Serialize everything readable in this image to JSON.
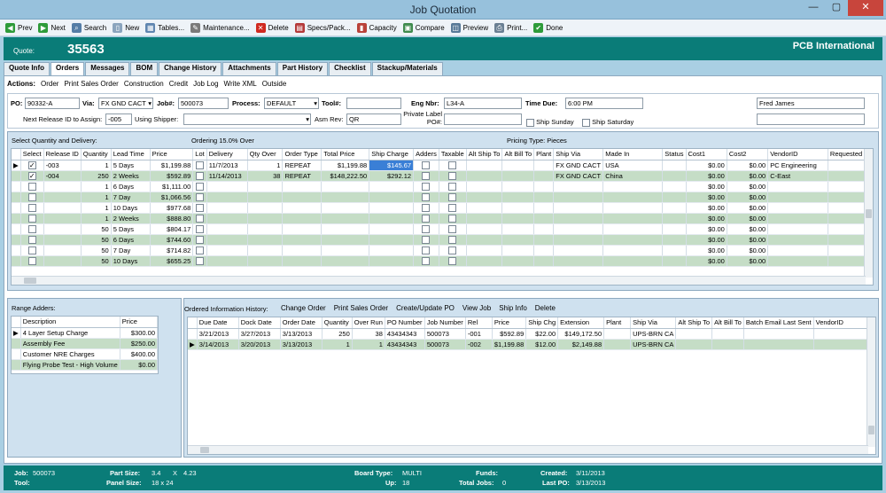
{
  "window": {
    "title": "Job Quotation",
    "min": "—",
    "max": "▢",
    "close": "✕"
  },
  "toolbar": [
    {
      "label": "Prev",
      "icon": "prev-icon",
      "color": "#2e9b3a",
      "glyph": "◀"
    },
    {
      "label": "Next",
      "icon": "next-icon",
      "color": "#2e9b3a",
      "glyph": "▶"
    },
    {
      "label": "Search",
      "icon": "search-icon",
      "color": "#557da6",
      "glyph": "⌕"
    },
    {
      "label": "New",
      "icon": "new-icon",
      "color": "#8aa4bd",
      "glyph": "▯"
    },
    {
      "label": "Tables...",
      "icon": "tables-icon",
      "color": "#5f86b0",
      "glyph": "▦"
    },
    {
      "label": "Maintenance...",
      "icon": "maintenance-icon",
      "color": "#7a7a7a",
      "glyph": "✎"
    },
    {
      "label": "Delete",
      "icon": "delete-icon",
      "color": "#d02a20",
      "glyph": "✕"
    },
    {
      "label": "Specs/Pack...",
      "icon": "specs-icon",
      "color": "#b43a3a",
      "glyph": "▤"
    },
    {
      "label": "Capacity",
      "icon": "capacity-icon",
      "color": "#b9423a",
      "glyph": "▮"
    },
    {
      "label": "Compare",
      "icon": "compare-icon",
      "color": "#3f8b4e",
      "glyph": "▣"
    },
    {
      "label": "Preview",
      "icon": "preview-icon",
      "color": "#587a98",
      "glyph": "◫"
    },
    {
      "label": "Print...",
      "icon": "print-icon",
      "color": "#6a7f93",
      "glyph": "⎙"
    },
    {
      "label": "Done",
      "icon": "done-icon",
      "color": "#2e9b3a",
      "glyph": "✔"
    }
  ],
  "header": {
    "quote_label": "Quote:",
    "quote_number": "35563",
    "company": "PCB International"
  },
  "tabs": [
    "Quote Info",
    "Orders",
    "Messages",
    "BOM",
    "Change History",
    "Attachments",
    "Part History",
    "Checklist",
    "Stackup/Materials"
  ],
  "active_tab": "Orders",
  "actions": {
    "label": "Actions:",
    "items": [
      "Order",
      "Print Sales Order",
      "Construction",
      "Credit",
      "Job Log",
      "Write XML",
      "Outside"
    ]
  },
  "form": {
    "po_label": "PO:",
    "po_value": "90332-A",
    "via_label": "Via:",
    "via_value": "FX GND CACT",
    "job_label": "Job#:",
    "job_value": "500073",
    "process_label": "Process:",
    "process_value": "DEFAULT",
    "tool_label": "Tool#:",
    "tool_value": "",
    "eng_label": "Eng Nbr:",
    "eng_value": "L34-A",
    "time_due_label": "Time Due:",
    "time_due_value": "6:00 PM",
    "person_value": "Fred James",
    "next_release_label": "Next Release ID to Assign:",
    "next_release_value": "-005",
    "shipper_label": "Using Shipper:",
    "shipper_value": "",
    "asm_rev_label": "Asm Rev:",
    "asm_rev_value": "QR",
    "private_label_line1": "Private Label",
    "private_label_line2": "PO#:",
    "private_label_value": "",
    "ship_sunday_label": "Ship Sunday",
    "ship_saturday_label": "Ship Saturday",
    "extra_value": ""
  },
  "quantity": {
    "title": "Select Quantity and Delivery:",
    "ordering_text": "Ordering 15.0% Over",
    "pricing_text": "Pricing Type: Pieces",
    "columns": [
      "",
      "Select",
      "Release ID",
      "Quantity",
      "Lead Time",
      "Price",
      "Lot",
      "Delivery",
      "Qty Over",
      "Order Type",
      "Total Price",
      "Ship Charge",
      "Adders",
      "Taxable",
      "Alt Ship To",
      "Alt Bill To",
      "Plant",
      "Ship Via",
      "Made In",
      "Status",
      "Cost1",
      "Cost2",
      "VendorID",
      "Requested D"
    ],
    "rows": [
      [
        "▶",
        "✓",
        "-003",
        "1",
        "5 Days",
        "$1,199.88",
        "",
        "11/7/2013",
        "1",
        "REPEAT",
        "$1,199.88",
        "$145.67",
        "",
        "",
        "",
        "",
        "",
        "FX GND CACT",
        "USA",
        "",
        "$0.00",
        "$0.00",
        "PC Engineering",
        ""
      ],
      [
        "",
        "✓",
        "-004",
        "250",
        "2 Weeks",
        "$592.89",
        "",
        "11/14/2013",
        "38",
        "REPEAT",
        "$148,222.50",
        "$292.12",
        "",
        "",
        "",
        "",
        "",
        "FX GND CACT",
        "China",
        "",
        "$0.00",
        "$0.00",
        "C-East",
        ""
      ],
      [
        "",
        "",
        "",
        "1",
        "6 Days",
        "$1,111.00",
        "",
        "",
        "",
        "",
        "",
        "",
        "",
        "",
        "",
        "",
        "",
        "",
        "",
        "",
        "$0.00",
        "$0.00",
        "",
        ""
      ],
      [
        "",
        "",
        "",
        "1",
        "7 Day",
        "$1,066.56",
        "",
        "",
        "",
        "",
        "",
        "",
        "",
        "",
        "",
        "",
        "",
        "",
        "",
        "",
        "$0.00",
        "$0.00",
        "",
        ""
      ],
      [
        "",
        "",
        "",
        "1",
        "10 Days",
        "$977.68",
        "",
        "",
        "",
        "",
        "",
        "",
        "",
        "",
        "",
        "",
        "",
        "",
        "",
        "",
        "$0.00",
        "$0.00",
        "",
        ""
      ],
      [
        "",
        "",
        "",
        "1",
        "2 Weeks",
        "$888.80",
        "",
        "",
        "",
        "",
        "",
        "",
        "",
        "",
        "",
        "",
        "",
        "",
        "",
        "",
        "$0.00",
        "$0.00",
        "",
        ""
      ],
      [
        "",
        "",
        "",
        "50",
        "5 Days",
        "$804.17",
        "",
        "",
        "",
        "",
        "",
        "",
        "",
        "",
        "",
        "",
        "",
        "",
        "",
        "",
        "$0.00",
        "$0.00",
        "",
        ""
      ],
      [
        "",
        "",
        "",
        "50",
        "6 Days",
        "$744.60",
        "",
        "",
        "",
        "",
        "",
        "",
        "",
        "",
        "",
        "",
        "",
        "",
        "",
        "",
        "$0.00",
        "$0.00",
        "",
        ""
      ],
      [
        "",
        "",
        "",
        "50",
        "7 Day",
        "$714.82",
        "",
        "",
        "",
        "",
        "",
        "",
        "",
        "",
        "",
        "",
        "",
        "",
        "",
        "",
        "$0.00",
        "$0.00",
        "",
        ""
      ],
      [
        "",
        "",
        "",
        "50",
        "10 Days",
        "$655.25",
        "",
        "",
        "",
        "",
        "",
        "",
        "",
        "",
        "",
        "",
        "",
        "",
        "",
        "",
        "$0.00",
        "$0.00",
        "",
        ""
      ]
    ]
  },
  "range_adders": {
    "title": "Range Adders:",
    "columns": [
      "",
      "Description",
      "Price"
    ],
    "rows": [
      [
        "▶",
        "4 Layer Setup Charge",
        "$300.00"
      ],
      [
        "",
        "Assembly Fee",
        "$250.00"
      ],
      [
        "",
        "Customer NRE Charges",
        "$400.00"
      ],
      [
        "",
        "Flying Probe Test - High Volume",
        "$0.00"
      ]
    ]
  },
  "history": {
    "title": "Ordered Information History:",
    "actions": [
      "Change Order",
      "Print Sales Order",
      "Create/Update PO",
      "View Job",
      "Ship Info",
      "Delete"
    ],
    "columns": [
      "",
      "Due Date",
      "Dock Date",
      "Order Date",
      "Quantity",
      "Over Run",
      "PO Number",
      "Job Number",
      "Rel",
      "Price",
      "Ship Chg",
      "Extension",
      "Plant",
      "Ship Via",
      "Alt Ship To",
      "Alt Bill To",
      "Batch Email Last Sent",
      "VendorID"
    ],
    "rows": [
      [
        "",
        "3/21/2013",
        "3/27/2013",
        "3/13/2013",
        "250",
        "38",
        "43434343",
        "500073",
        "-001",
        "$592.89",
        "$22.00",
        "$149,172.50",
        "",
        "UPS-BRN CA",
        "",
        "",
        "",
        ""
      ],
      [
        "▶",
        "3/14/2013",
        "3/20/2013",
        "3/13/2013",
        "1",
        "1",
        "43434343",
        "500073",
        "-002",
        "$1,199.88",
        "$12.00",
        "$2,149.88",
        "",
        "UPS-BRN CA",
        "",
        "",
        "",
        ""
      ]
    ]
  },
  "footer": {
    "job_label": "Job:",
    "job_value": "500073",
    "tool_label": "Tool:",
    "tool_value": "",
    "part_size_label": "Part Size:",
    "part_size_w": "3.4",
    "part_size_x": "X",
    "part_size_h": "4.23",
    "panel_size_label": "Panel Size:",
    "panel_size_value": "18 x 24",
    "board_type_label": "Board Type:",
    "board_type_value": "MULTI",
    "up_label": "Up:",
    "up_value": "18",
    "funds_label": "Funds:",
    "funds_value": "",
    "total_jobs_label": "Total Jobs:",
    "total_jobs_value": "0",
    "created_label": "Created:",
    "created_value": "3/11/2013",
    "last_po_label": "Last PO:",
    "last_po_value": "3/13/2013"
  }
}
